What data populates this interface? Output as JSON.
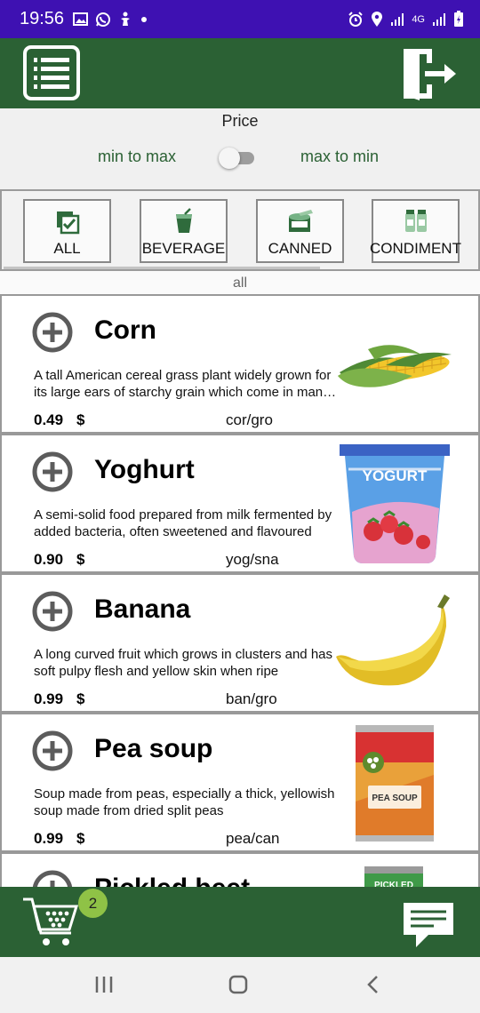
{
  "status_bar": {
    "time": "19:56",
    "network": "4G",
    "left_icons": [
      "image-icon",
      "whatsapp-icon",
      "accessibility-icon",
      "dot-icon"
    ],
    "right_icons": [
      "alarm-icon",
      "location-icon",
      "signal-icon",
      "signal-icon",
      "battery-icon"
    ]
  },
  "app_bar": {
    "menu_icon": "list-menu-icon",
    "logout_icon": "logout-icon"
  },
  "price_sort": {
    "title": "Price",
    "option_left": "min to max",
    "option_right": "max to min",
    "toggle_on": false
  },
  "categories": [
    {
      "label": "ALL",
      "icon": "checkbox-stack-icon"
    },
    {
      "label": "BEVERAGE",
      "icon": "drink-icon"
    },
    {
      "label": "CANNED",
      "icon": "canned-food-icon"
    },
    {
      "label": "CONDIMENT",
      "icon": "salt-pepper-icon"
    }
  ],
  "active_filter": "all",
  "products": [
    {
      "name": "Corn",
      "description": "A tall American cereal grass plant widely grown for its large ears of starchy grain which come in many varieties",
      "price": "0.49",
      "currency": "$",
      "code": "cor/gro",
      "image": "corn-image"
    },
    {
      "name": "Yoghurt",
      "description": "A semi-solid food prepared from milk fermented by added bacteria, often sweetened and flavoured",
      "price": "0.90",
      "currency": "$",
      "code": "yog/sna",
      "image": "yogurt-image",
      "image_text": "YOGURT"
    },
    {
      "name": "Banana",
      "description": "A long curved fruit which grows in clusters and has soft pulpy flesh and yellow skin when ripe",
      "price": "0.99",
      "currency": "$",
      "code": "ban/gro",
      "image": "banana-image"
    },
    {
      "name": "Pea soup",
      "description": "Soup made from peas, especially a thick, yellowish soup made from dried split peas",
      "price": "0.99",
      "currency": "$",
      "code": "pea/can",
      "image": "pea-soup-can-image",
      "image_text": "PEA SOUP"
    },
    {
      "name": "Pickled beet",
      "description": "",
      "price": "",
      "currency": "",
      "code": "",
      "image": "pickled-jar-image",
      "image_text": "PICKLED"
    }
  ],
  "bottom_bar": {
    "cart_count": "2",
    "cart_icon": "shopping-cart-icon",
    "chat_icon": "chat-icon"
  },
  "colors": {
    "primary": "#2b6134",
    "status_bar": "#3e11b2",
    "badge": "#8fc246",
    "accent_text": "#2b6134"
  }
}
